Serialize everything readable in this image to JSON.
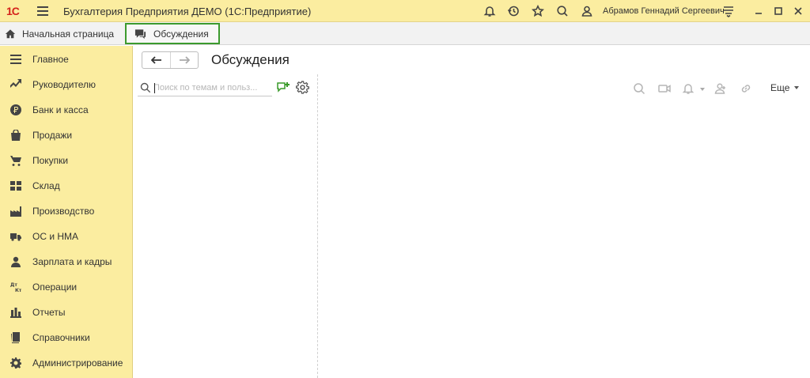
{
  "titlebar": {
    "logo": "1С",
    "app_title": "Бухгалтерия Предприятия ДЕМО  (1С:Предприятие)",
    "user_name": "Абрамов Геннадий Сергеевич"
  },
  "tabs": {
    "home_label": "Начальная страница",
    "active_label": "Обсуждения"
  },
  "sidebar": {
    "items": [
      {
        "label": "Главное",
        "icon": "menu-list-icon"
      },
      {
        "label": "Руководителю",
        "icon": "trend-chart-icon"
      },
      {
        "label": "Банк и касса",
        "icon": "ruble-coin-icon"
      },
      {
        "label": "Продажи",
        "icon": "shopping-bag-icon"
      },
      {
        "label": "Покупки",
        "icon": "shopping-cart-icon"
      },
      {
        "label": "Склад",
        "icon": "warehouse-grid-icon"
      },
      {
        "label": "Производство",
        "icon": "factory-icon"
      },
      {
        "label": "ОС и НМА",
        "icon": "truck-icon"
      },
      {
        "label": "Зарплата и кадры",
        "icon": "person-icon"
      },
      {
        "label": "Операции",
        "icon": "dt-kt-icon"
      },
      {
        "label": "Отчеты",
        "icon": "bar-chart-icon"
      },
      {
        "label": "Справочники",
        "icon": "books-icon"
      },
      {
        "label": "Администрирование",
        "icon": "gear-icon"
      }
    ]
  },
  "main": {
    "title": "Обсуждения",
    "search": {
      "placeholder": "Поиск по темам и польз...",
      "value": ""
    },
    "more_label": "Еще"
  },
  "colors": {
    "panel_yellow": "#fbeda0",
    "active_tab_border": "#3c9a2e",
    "logo_red": "#d4231c"
  }
}
